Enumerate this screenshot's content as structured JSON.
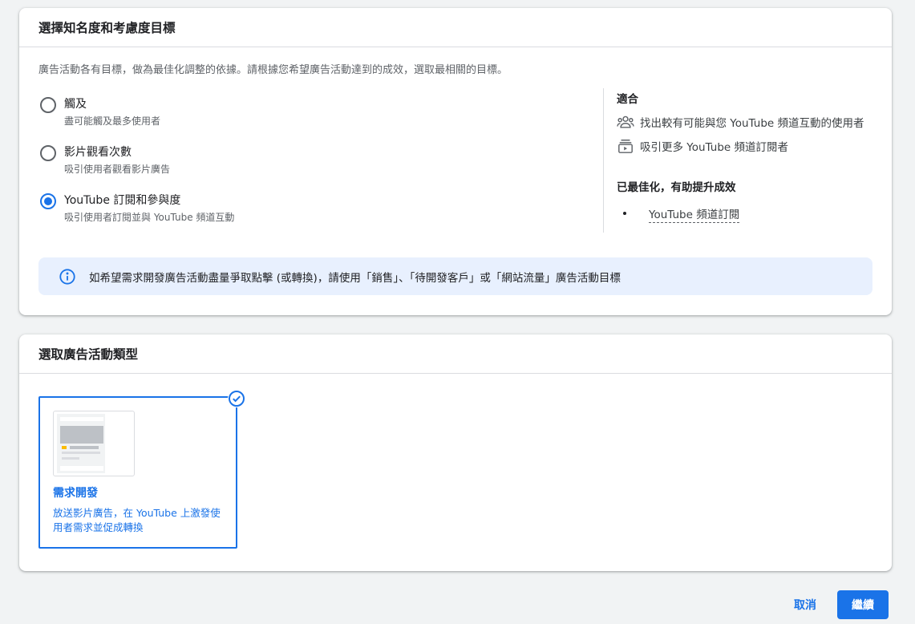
{
  "goal_section": {
    "title": "選擇知名度和考慮度目標",
    "description": "廣告活動各有目標，做為最佳化調整的依據。請根據您希望廣告活動達到的成效，選取最相關的目標。",
    "options": [
      {
        "title": "觸及",
        "subtitle": "盡可能觸及最多使用者",
        "selected": false
      },
      {
        "title": "影片觀看次數",
        "subtitle": "吸引使用者觀看影片廣告",
        "selected": false
      },
      {
        "title": "YouTube 訂閱和參與度",
        "subtitle": "吸引使用者訂閱並與 YouTube 頻道互動",
        "selected": true
      }
    ],
    "side": {
      "suitable_heading": "適合",
      "suitable_items": [
        {
          "icon": "people-icon",
          "text": "找出較有可能與您 YouTube 頻道互動的使用者"
        },
        {
          "icon": "subscriptions-icon",
          "text": "吸引更多 YouTube 頻道訂閱者"
        }
      ],
      "optimized_heading": "已最佳化，有助提升成效",
      "optimized_items": [
        "YouTube 頻道訂閱"
      ]
    },
    "info_banner": "如希望需求開發廣告活動盡量爭取點擊 (或轉換)，請使用「銷售」、「待開發客戶」或「網站流量」廣告活動目標"
  },
  "type_section": {
    "title": "選取廣告活動類型",
    "card": {
      "title": "需求開發",
      "description": "放送影片廣告，在 YouTube 上激發使用者需求並促成轉換",
      "selected": true
    }
  },
  "footer": {
    "cancel_label": "取消",
    "continue_label": "繼續"
  },
  "colors": {
    "accent": "#1a73e8",
    "info_bg": "#e8f0fe",
    "page_bg": "#f1f3f4"
  }
}
